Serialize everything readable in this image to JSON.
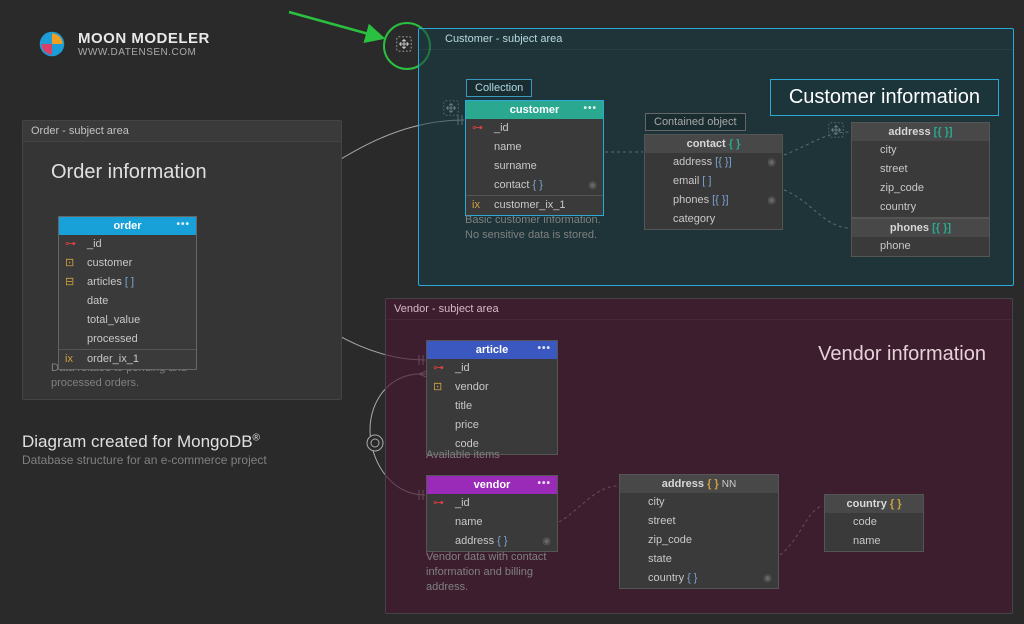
{
  "brand": {
    "title": "MOON MODELER",
    "url": "WWW.DATENSEN.COM"
  },
  "diagram_note": {
    "heading": "Diagram created for MongoDB",
    "reg": "®",
    "sub": "Database structure for an e-commerce project"
  },
  "areas": {
    "order": {
      "header": "Order - subject area",
      "title": "Order information",
      "note": "Data related to pending and\nprocessed orders."
    },
    "customer": {
      "header": "Customer - subject area",
      "title": "Customer information"
    },
    "vendor": {
      "header": "Vendor - subject area",
      "title": "Vendor information"
    }
  },
  "labels": {
    "collection": "Collection",
    "contained_object": "Contained object"
  },
  "entities": {
    "order": {
      "name": "order",
      "fields": [
        {
          "key": "pk",
          "name": "_id"
        },
        {
          "key": "obj",
          "name": "customer"
        },
        {
          "key": "arrobj",
          "name": "articles",
          "type": "[ ]"
        },
        {
          "name": "date"
        },
        {
          "name": "total_value"
        },
        {
          "name": "processed"
        }
      ],
      "indexes": [
        {
          "name": "order_ix_1"
        }
      ]
    },
    "customer": {
      "name": "customer",
      "fields": [
        {
          "key": "pk",
          "name": "_id"
        },
        {
          "name": "name"
        },
        {
          "name": "surname"
        },
        {
          "name": "contact",
          "type": "{ }",
          "eye": true
        }
      ],
      "indexes": [
        {
          "name": "customer_ix_1"
        }
      ],
      "note": "Basic customer information.\nNo sensitive data is stored."
    },
    "contact": {
      "name": "contact",
      "type": "{ }",
      "fields": [
        {
          "name": "address",
          "type": "[{ }]",
          "eye": true
        },
        {
          "name": "email",
          "type": "[ ]"
        },
        {
          "name": "phones",
          "type": "[{ }]",
          "eye": true
        },
        {
          "name": "category"
        }
      ]
    },
    "address_c": {
      "name": "address",
      "type": "[{ }]",
      "fields": [
        {
          "name": "city"
        },
        {
          "name": "street"
        },
        {
          "name": "zip_code"
        },
        {
          "name": "country"
        }
      ]
    },
    "phones": {
      "name": "phones",
      "type": "[{ }]",
      "fields": [
        {
          "name": "phone"
        }
      ]
    },
    "article": {
      "name": "article",
      "fields": [
        {
          "key": "pk",
          "name": "_id"
        },
        {
          "key": "obj",
          "name": "vendor"
        },
        {
          "name": "title"
        },
        {
          "name": "price"
        },
        {
          "name": "code"
        }
      ],
      "note": "Available items"
    },
    "vendor": {
      "name": "vendor",
      "fields": [
        {
          "key": "pk",
          "name": "_id"
        },
        {
          "name": "name"
        },
        {
          "name": "address",
          "type": "{ }",
          "eye": true
        }
      ],
      "note": "Vendor data with contact\ninformation and billing\naddress."
    },
    "address_v": {
      "name": "address",
      "type": "{ }",
      "nn": "NN",
      "fields": [
        {
          "name": "city"
        },
        {
          "name": "street"
        },
        {
          "name": "zip_code"
        },
        {
          "name": "state"
        },
        {
          "name": "country",
          "type": "{ }",
          "eye": true
        }
      ]
    },
    "country": {
      "name": "country",
      "type": "{ }",
      "fields": [
        {
          "name": "code"
        },
        {
          "name": "name"
        }
      ]
    }
  }
}
